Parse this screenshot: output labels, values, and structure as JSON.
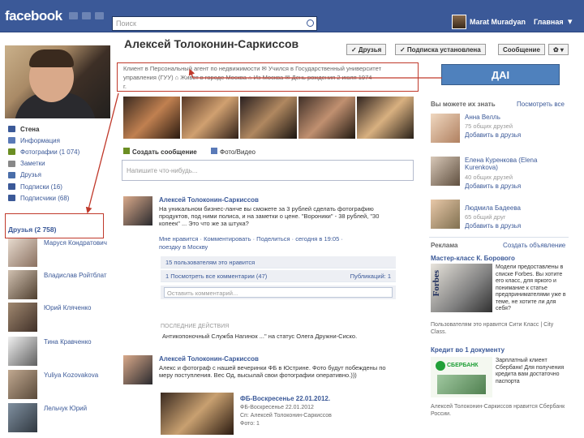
{
  "topbar": {
    "logo": "facebook",
    "search_placeholder": "Поиск",
    "user_name": "Marat Muradyan",
    "home_label": "Главная"
  },
  "profile": {
    "name": "Алексей Толоконин-Саркиссов",
    "buttons": [
      "✓ Друзья",
      "✓ Подписка установлена",
      "Сообщение",
      "✿ ▾"
    ],
    "info_line1": "Клиент в Персональный агент по недвижимости ✉ Учился в Государственный университет",
    "info_line2": "управления (ГУУ) ⌂ Живет в городе Москва ⌂ Из Москва ✉ День рождения 2 июля 1974",
    "info_line3": "г."
  },
  "nav": [
    {
      "label": "Стена",
      "color": "#3b5998"
    },
    {
      "label": "Информация",
      "color": "#5a7ab8"
    },
    {
      "label": "Фотографии (1 074)",
      "color": "#6b8e23"
    },
    {
      "label": "Заметки",
      "color": "#888888"
    },
    {
      "label": "Друзья",
      "color": "#4a6ea9"
    },
    {
      "label": "Подписки (16)",
      "color": "#3b5998"
    },
    {
      "label": "Подписчики (68)",
      "color": "#3b5998"
    }
  ],
  "friends_header": "Друзья (2 758)",
  "friends": [
    {
      "name": "Маруся Кондратович"
    },
    {
      "name": "Владислав Ройтблат"
    },
    {
      "name": "Юрий Кляченко"
    },
    {
      "name": "Тина Кравченко"
    },
    {
      "name": "Yuliya Kozovakova"
    },
    {
      "name": "Лельчук Юрий"
    }
  ],
  "composer": {
    "tab1": "Создать сообщение",
    "tab2": "Фото/Видео",
    "placeholder": "Напишите что-нибудь..."
  },
  "post1": {
    "author": "Алексей Толоконин-Саркиссов",
    "text": "На уникальном бизнес-ланче вы сможете за 3 рублей сделать фотографию продуктов, под ними полиса, и на заметки о цене. \"Вороники\" - 38 рублей, \"30 копеек\" ... Это что же за штука?",
    "actions": "Мне нравится · Комментировать · Поделиться · сегодня в 19:05 ·",
    "actions2": "поездку в Москву",
    "likes": "15 пользователям это нравится",
    "comments": "1 Посмотреть все комментарии (47)",
    "shares": "Публикаций: 1",
    "comment_placeholder": "Оставить комментарий..."
  },
  "recent": {
    "label": "ПОСЛЕДНИЕ ДЕЙСТВИЯ",
    "text": "Антикопоночный Служба Нагинок ...\" на статус Олега Дружни-Сиско."
  },
  "post2": {
    "author": "Алексей Толоконин-Саркиссов",
    "text": "Алекс и фотограф с нашей вечеринки ФБ в Юстрине. Фото будут побеждены по меру поступления. Вес Од, высылай свои фотографии оперативно.)))",
    "album_title": "ФБ-Воскресенье 22.01.2012.",
    "album_sub1": "ФБ-Воскресенье 22.01.2012",
    "album_sub2": "Сп: Алексей Толоконин-Саркиссов",
    "album_sub3": "Фото: 1"
  },
  "right": {
    "pymk_title": "Вы можете их знать",
    "pymk_link": "Посмотреть все",
    "people": [
      {
        "name": "Анна Велль",
        "mutual": "75 общих друзей",
        "add": "Добавить в друзья"
      },
      {
        "name": "Елена Куренкова (Elena Kurenkova)",
        "mutual": "40 общих друзей",
        "add": "Добавить в друзья"
      },
      {
        "name": "Людмила Бадеева",
        "mutual": "65 общий друг",
        "add": "Добавить в друзья"
      }
    ],
    "ads_title": "Реклама",
    "ads_link": "Создать объявление",
    "ad1_title": "Мастер-класс К. Борового",
    "ad1_text": "Модели предоставлены в списке Forbes. Вы хотите его класс, для яркого и понимание к статье предпринимателями уже в теме, не хотите ли для себя?",
    "ad1_foot": "Пользователям это нравится Сити Класс | City Class.",
    "ad2_title": "Кредит во 1 документу",
    "ad2_text": "Зарплатный клиент Сбербанк! Для получения кредита вам достаточно паспорта",
    "ad2_foot": "Алексей Толоконин-Саркиссов нравится Сбербанк России.",
    "sber": "СБЕРБАНК"
  },
  "annotation": {
    "label": "ДАI"
  }
}
